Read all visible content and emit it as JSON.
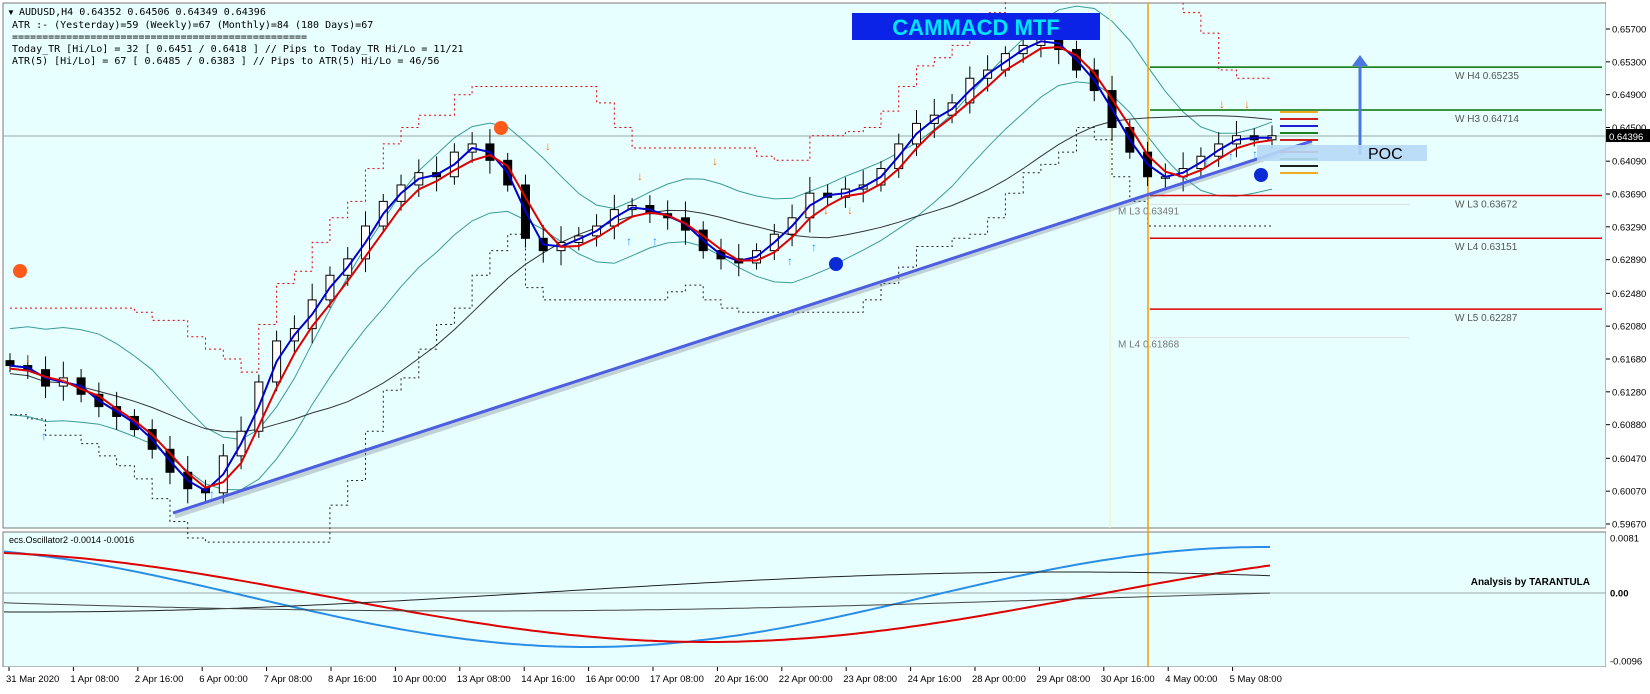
{
  "window_title": "AUDUSD,H4  0.64352 0.64506 0.64349 0.64396",
  "info_lines": [
    "ATR :- (Yesterday)=59       (Weekly)=67       (Monthly)=84       (180 Days)=67",
    "=================================================",
    "Today_TR [Hi/Lo] = 32 [ 0.6451 / 0.6418 ]  // Pips to Today_TR Hi/Lo  = 11/21",
    "ATR(5)      [Hi/Lo] = 67 [ 0.6485 / 0.6383 ]  //  Pips to ATR(5) Hi/Lo      = 46/56"
  ],
  "banner_text": "CAMMACD MTF",
  "poc_label": "POC",
  "osc_label": "ecs.Oscillator2 -0.0014 -0.0016",
  "analysis_label": "Analysis by TARANTULA",
  "current_price_label": "0.64396",
  "level_labels": [
    {
      "text": "W  H4  0.65235",
      "price": 0.65235,
      "color": "#007000"
    },
    {
      "text": "W  H3  0.64714",
      "price": 0.64714,
      "color": "#007000"
    },
    {
      "text": "W  L3  0.63672",
      "price": 0.63672,
      "color": "#dd0000"
    },
    {
      "text": "W  L4  0.63151",
      "price": 0.63151,
      "color": "#dd0000"
    },
    {
      "text": "W  L5  0.62287",
      "price": 0.62287,
      "color": "#dd0000"
    },
    {
      "text": "M  L3  0.63491",
      "price": 0.63491,
      "color": "#888888"
    },
    {
      "text": "M  L4  0.61868",
      "price": 0.61868,
      "color": "#888888"
    }
  ],
  "colors": {
    "background": "#e8ffff",
    "blue_ma": "#0000cc",
    "red_ma": "#dd0000",
    "trendline": "#4d5ee0",
    "bands": "#3a9a9a",
    "banner_bg": "#0b23e6",
    "banner_text": "#00e5ff",
    "osc_blue": "#2a8ee6",
    "osc_red": "#dd0000",
    "orange_dot": "#ff5a1a",
    "blue_dot": "#0a2ad6"
  },
  "chart_data": [
    {
      "type": "line",
      "subtype": "candlestick",
      "symbol": "AUDUSD",
      "timeframe": "H4",
      "ohlc_last": {
        "open": 0.64352,
        "high": 0.64506,
        "low": 0.64349,
        "close": 0.64396
      },
      "ylim": [
        0.5967,
        0.6579
      ],
      "yticks": [
        "0.65700",
        "0.65300",
        "0.64900",
        "0.64500",
        "0.64090",
        "0.63690",
        "0.63290",
        "0.62890",
        "0.62480",
        "0.62080",
        "0.61680",
        "0.61280",
        "0.60880",
        "0.60470",
        "0.60070",
        "0.59670"
      ],
      "xticks": [
        "31 Mar 2020",
        "1 Apr 08:00",
        "2 Apr 16:00",
        "6 Apr 00:00",
        "7 Apr 08:00",
        "8 Apr 16:00",
        "10 Apr 00:00",
        "13 Apr 08:00",
        "14 Apr 16:00",
        "16 Apr 00:00",
        "17 Apr 08:00",
        "20 Apr 16:00",
        "22 Apr 00:00",
        "23 Apr 08:00",
        "24 Apr 16:00",
        "28 Apr 00:00",
        "29 Apr 08:00",
        "30 Apr 16:00",
        "4 May 00:00",
        "5 May 08:00"
      ],
      "close_path": [
        0.616,
        0.6155,
        0.6135,
        0.6145,
        0.6125,
        0.611,
        0.6098,
        0.6082,
        0.6058,
        0.603,
        0.601,
        0.6005,
        0.605,
        0.608,
        0.614,
        0.619,
        0.6205,
        0.624,
        0.627,
        0.629,
        0.633,
        0.636,
        0.638,
        0.6395,
        0.639,
        0.642,
        0.643,
        0.641,
        0.638,
        0.6315,
        0.63,
        0.631,
        0.6318,
        0.633,
        0.635,
        0.6355,
        0.6345,
        0.634,
        0.6325,
        0.63,
        0.629,
        0.6285,
        0.63,
        0.632,
        0.634,
        0.637,
        0.6365,
        0.6375,
        0.638,
        0.64,
        0.643,
        0.6455,
        0.6465,
        0.648,
        0.651,
        0.652,
        0.654,
        0.655,
        0.656,
        0.6545,
        0.652,
        0.6495,
        0.645,
        0.642,
        0.639,
        0.639,
        0.64,
        0.6415,
        0.643,
        0.644,
        0.6435,
        0.644
      ]
    },
    {
      "type": "line",
      "name": "ecs.Oscillator2",
      "values_shown": [
        -0.0014,
        -0.0016
      ],
      "ylim": [
        -0.0096,
        0.0081
      ],
      "yticks": [
        "0.0081",
        "0.00",
        "-0.0096"
      ]
    }
  ]
}
